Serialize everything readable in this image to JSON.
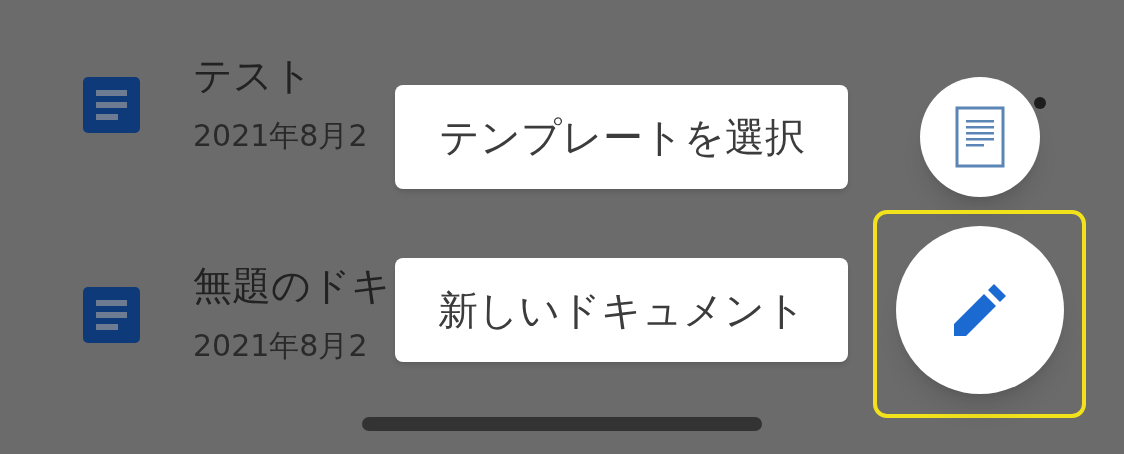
{
  "documents": [
    {
      "title": "テスト",
      "date": "2021年8月2"
    },
    {
      "title": "無題のドキ",
      "date": "2021年8月2"
    }
  ],
  "speed_dial": {
    "actions": [
      {
        "label": "テンプレートを選択",
        "kind": "template",
        "badge": true
      },
      {
        "label": "新しいドキュメント",
        "kind": "new",
        "highlighted": true
      }
    ]
  }
}
